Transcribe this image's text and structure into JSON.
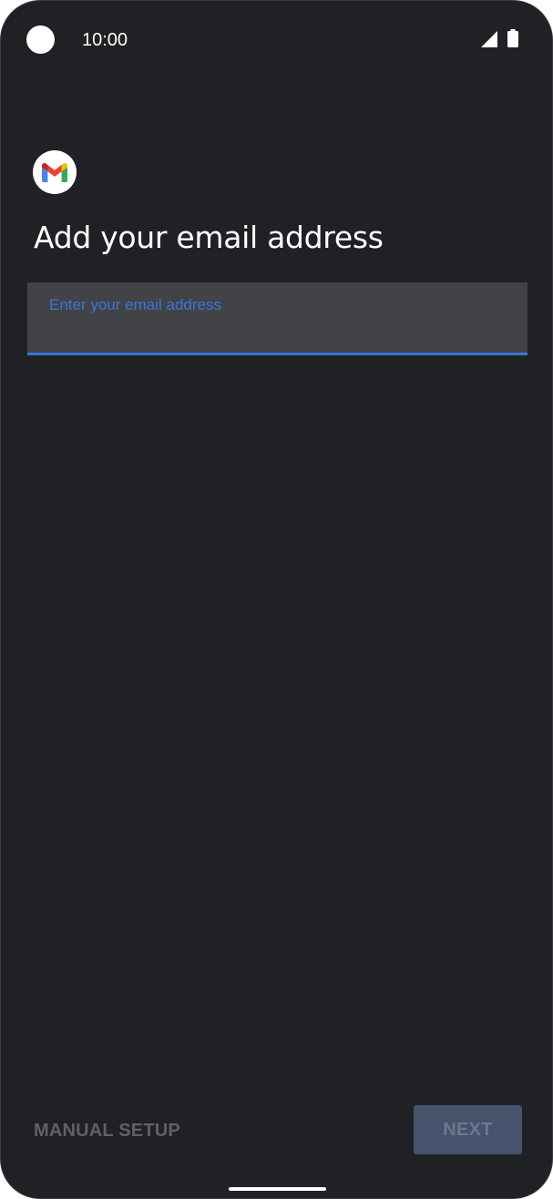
{
  "status_bar": {
    "time": "10:00",
    "icons": [
      "camera-cutout",
      "cellular-signal-icon",
      "battery-icon"
    ]
  },
  "app": {
    "logo_icon": "gmail-logo-icon"
  },
  "page": {
    "title": "Add your email address"
  },
  "email_field": {
    "label": "Enter your email address",
    "value": ""
  },
  "actions": {
    "manual_setup_label": "MANUAL SETUP",
    "next_label": "NEXT"
  },
  "colors": {
    "background": "#202124",
    "field_background": "#414347",
    "accent": "#3c73d6",
    "next_button_disabled": "#46536c",
    "manual_setup_disabled": "#5f6164",
    "gmail_red": "#ea4335",
    "gmail_blue": "#4285f4",
    "gmail_green": "#34a853",
    "gmail_yellow": "#fbbc04"
  }
}
